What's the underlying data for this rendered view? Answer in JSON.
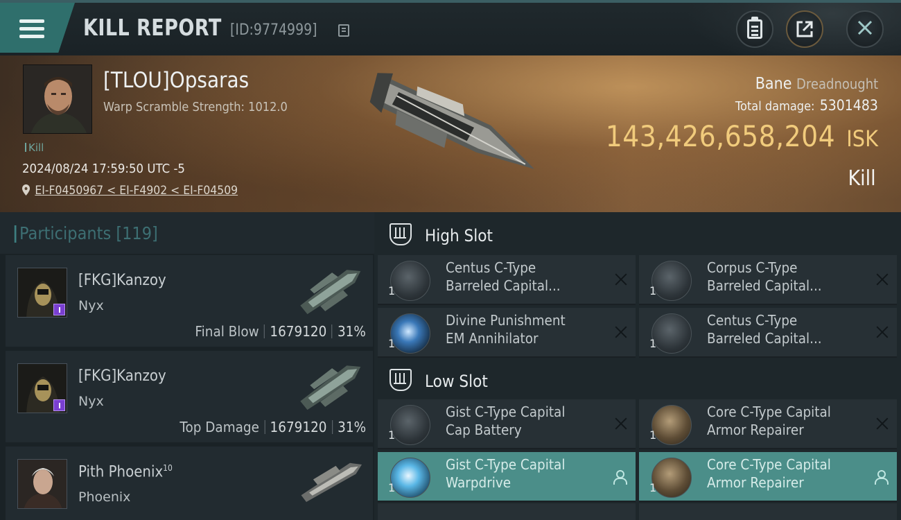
{
  "header": {
    "title": "KILL REPORT",
    "report_id": "[ID:9774999]"
  },
  "victim": {
    "pilot": "[TLOU]Opsaras",
    "warp_scramble": "Warp Scramble Strength: 1012.0",
    "tag": "Kill",
    "datetime": "2024/08/24 17:59:50 UTC -5",
    "location": "EI-F0450967 < EI-F4902 < EI-F04509",
    "ship": "Bane",
    "ship_class": "Dreadnought",
    "total_damage_label": "Total damage:",
    "total_damage": "5301483",
    "isk_value": "143,426,658,204",
    "isk_unit": "ISK",
    "outcome": "Kill"
  },
  "participants": {
    "title": "Participants",
    "count": "[119]",
    "items": [
      {
        "name": "[FKG]Kanzoy",
        "ship": "Nyx",
        "role": "Final Blow",
        "damage": "1679120",
        "pct": "31%"
      },
      {
        "name": "[FKG]Kanzoy",
        "ship": "Nyx",
        "role": "Top Damage",
        "damage": "1679120",
        "pct": "31%"
      },
      {
        "name": "Pith Phoenix",
        "name_sup": "10",
        "ship": "Phoenix"
      }
    ]
  },
  "fitting": {
    "high_slot": {
      "title": "High Slot",
      "modules": [
        {
          "qty": "1",
          "line1": "Centus C-Type",
          "line2": "Barreled Capital..."
        },
        {
          "qty": "1",
          "line1": "Corpus C-Type",
          "line2": "Barreled Capital..."
        },
        {
          "qty": "1",
          "line1": "Divine Punishment",
          "line2": "EM Annihilator"
        },
        {
          "qty": "1",
          "line1": "Centus C-Type",
          "line2": "Barreled Capital..."
        }
      ]
    },
    "low_slot": {
      "title": "Low Slot",
      "modules": [
        {
          "qty": "1",
          "line1": "Gist C-Type Capital",
          "line2": "Cap Battery"
        },
        {
          "qty": "1",
          "line1": "Core C-Type Capital",
          "line2": "Armor Repairer"
        },
        {
          "qty": "1",
          "line1": "Gist C-Type Capital",
          "line2": "Warpdrive"
        },
        {
          "qty": "1",
          "line1": "Core C-Type Capital",
          "line2": "Armor Repairer"
        }
      ]
    }
  },
  "colors": {
    "accent_teal": "#2f6f6c",
    "isk_gold": "#f1cb7c",
    "highlight_row": "#4b8e89"
  }
}
